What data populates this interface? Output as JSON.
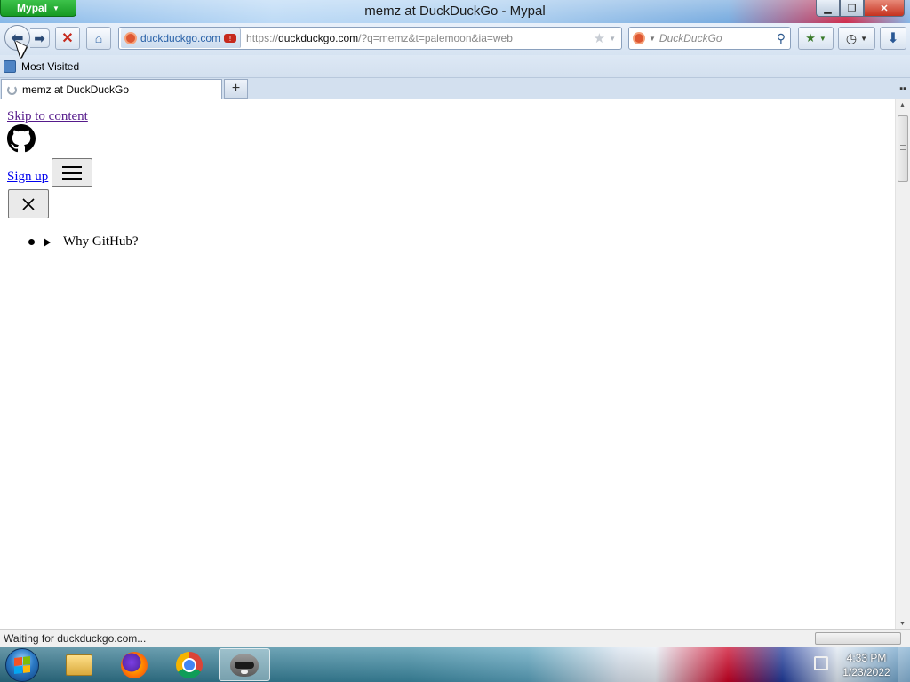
{
  "window": {
    "app_menu_label": "Mypal",
    "title": "memz at DuckDuckGo - Mypal",
    "controls": [
      "minimize",
      "restore",
      "close"
    ]
  },
  "navbar": {
    "back_icon": "arrow-left-icon",
    "forward_icon": "arrow-right-icon",
    "stop_icon": "x-icon",
    "home_icon": "home-icon",
    "identity_label": "duckduckgo.com",
    "url_scheme": "https://",
    "url_host": "duckduckgo.com",
    "url_rest": "/?q=memz&t=palemoon&ia=web",
    "search_placeholder": "DuckDuckGo"
  },
  "bookmarks": {
    "items": [
      {
        "label": "Most Visited"
      }
    ]
  },
  "tabs": {
    "items": [
      {
        "label": "memz at DuckDuckGo",
        "loading": true
      }
    ]
  },
  "content": {
    "skip_link": "Skip to content",
    "signup_link": "Sign up",
    "menu_item": "Why GitHub?"
  },
  "status": {
    "text": "Waiting for duckduckgo.com..."
  },
  "taskbar": {
    "apps": [
      "file-explorer",
      "firefox",
      "chrome",
      "mypal"
    ],
    "active_app": "mypal",
    "time": "4:33 PM",
    "date": "1/23/2022"
  },
  "colors": {
    "app_button": "#179a23",
    "link_visited": "#551a8b",
    "link": "#0000ee",
    "stop_red": "#c62a1e"
  }
}
